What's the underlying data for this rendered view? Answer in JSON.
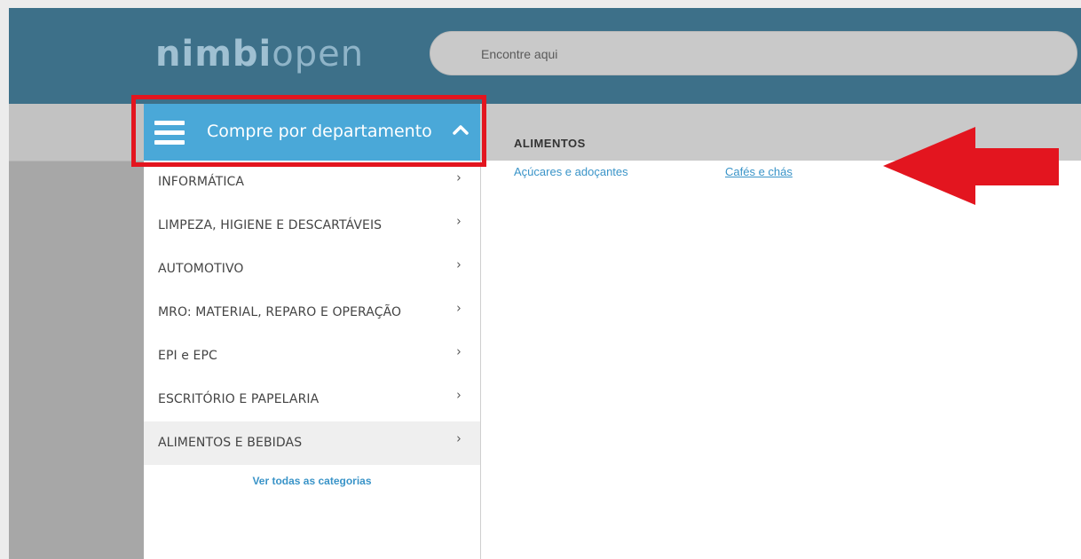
{
  "header": {
    "logo": {
      "part1": "nimbi",
      "part2": "open"
    },
    "search": {
      "placeholder": "Encontre aqui",
      "value": ""
    }
  },
  "menu": {
    "title": "Compre por departamento",
    "items": [
      {
        "label": "INFORMÁTICA"
      },
      {
        "label": "LIMPEZA, HIGIENE E DESCARTÁVEIS"
      },
      {
        "label": "AUTOMOTIVO"
      },
      {
        "label": "MRO: MATERIAL, REPARO E OPERAÇÃO"
      },
      {
        "label": "EPI e EPC"
      },
      {
        "label": "ESCRITÓRIO E PAPELARIA"
      },
      {
        "label": "ALIMENTOS E BEBIDAS"
      }
    ],
    "active_item": "ALIMENTOS E BEBIDAS",
    "see_all": "Ver todas as categorias",
    "chevron_glyph": "›"
  },
  "panel": {
    "section_title": "ALIMENTOS",
    "subcategories": [
      {
        "label": "Açúcares e adoçantes"
      },
      {
        "label": "Cafés e chás"
      }
    ]
  },
  "annotations": {
    "highlight_color": "#e3151f",
    "arrow_icon": "red-left-arrow-icon"
  },
  "colors": {
    "header_bg": "#3d7089",
    "menu_header_bg": "#4aa8d8",
    "link": "#3a94c8"
  }
}
